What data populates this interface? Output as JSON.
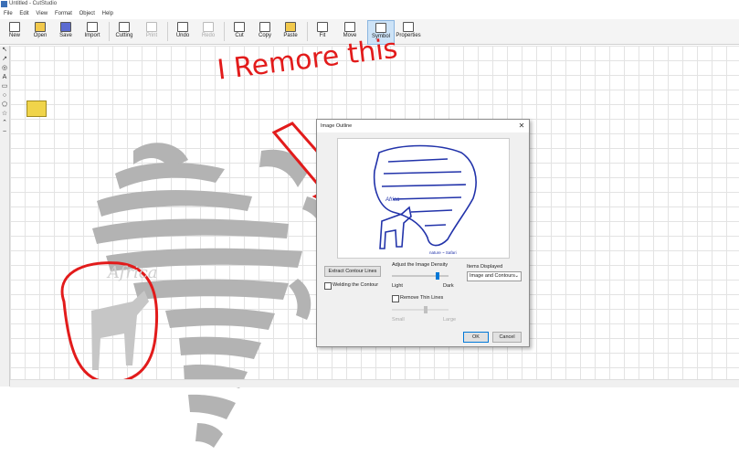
{
  "window": {
    "title": "Untitled - CutStudio"
  },
  "menu": {
    "items": [
      "File",
      "Edit",
      "View",
      "Format",
      "Object",
      "Help"
    ]
  },
  "toolbar": {
    "buttons": [
      "New",
      "Open",
      "Save",
      "Import",
      "Cutting",
      "Print",
      "Undo",
      "Redo",
      "Cut",
      "Copy",
      "Paste",
      "Fit",
      "Move",
      "Symbol",
      "Properties"
    ]
  },
  "lefttools": {
    "items": [
      "↖",
      "↗",
      "◎",
      "A",
      "▭",
      "○",
      "⬠",
      "☆",
      "⌃",
      "~"
    ]
  },
  "annotation": {
    "text": "I Remore this",
    "circle_text": "Africa"
  },
  "dialog": {
    "title": "Image Outline",
    "extract_button": "Extract Contour Lines",
    "welding_label": "Welding the Contour",
    "density_label": "Adjust the Image Density",
    "light_label": "Light",
    "dark_label": "Dark",
    "items_label": "Items Displayed",
    "items_value": "Image and Contours",
    "remove_label": "Remove Thin Lines",
    "size_small": "Small",
    "size_large": "Large",
    "ok_label": "OK",
    "cancel_label": "Cancel",
    "preview_caption": "Africa",
    "preview_footer": "nature ~ Safari",
    "density_level": 0.8,
    "thin_level": 0.6,
    "accent_color": "#0078d7"
  },
  "colors": {
    "annotation": "#e21b1b",
    "zebra": "#b3b3b3",
    "preview_blue": "#2233aa"
  }
}
